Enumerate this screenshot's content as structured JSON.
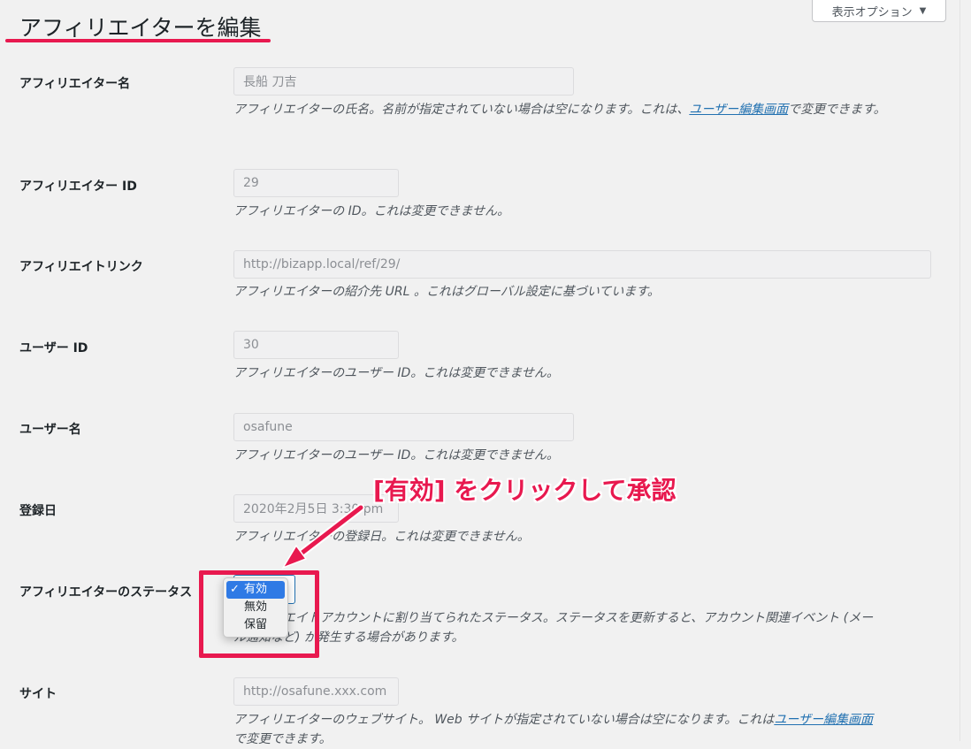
{
  "screen_options": {
    "label": "表示オプション",
    "arrow": "▼"
  },
  "page_title": "アフィリエイターを編集",
  "fields": {
    "name": {
      "label": "アフィリエイター名",
      "value": "長船 刀吉",
      "desc_before": "アフィリエイターの氏名。名前が指定されていない場合は空になります。これは、",
      "desc_link": "ユーザー編集画面",
      "desc_after": "で変更できます。"
    },
    "affiliate_id": {
      "label": "アフィリエイター ID",
      "value": "29",
      "desc": "アフィリエイターの ID。これは変更できません。"
    },
    "affiliate_link": {
      "label": "アフィリエイトリンク",
      "value": "http://bizapp.local/ref/29/",
      "desc": "アフィリエイターの紹介先 URL 。これはグローバル設定に基づいています。"
    },
    "user_id": {
      "label": "ユーザー ID",
      "value": "30",
      "desc": "アフィリエイターのユーザー ID。これは変更できません。"
    },
    "username": {
      "label": "ユーザー名",
      "value": "osafune",
      "desc": "アフィリエイターのユーザー ID。これは変更できません。"
    },
    "registered": {
      "label": "登録日",
      "value": "2020年2月5日 3:30 pm",
      "desc": "アフィリエイターの登録日。これは変更できません。"
    },
    "status": {
      "label": "アフィリエイターのステータス",
      "desc_line1": "アフィリエイトアカウントに割り当てられたステータス。ステータスを更新すると、アカウント関連イベント (メー",
      "desc_line2": "ル通知など) が発生する場合があります。",
      "options": [
        "有効",
        "無効",
        "保留"
      ],
      "selected": "有効",
      "check": "✓"
    },
    "site": {
      "label": "サイト",
      "value": "http://osafune.xxx.com",
      "desc_before": "アフィリエイターのウェブサイト。 Web サイトが指定されていない場合は空になります。これは",
      "desc_link": "ユーザー編集画面",
      "desc_after": "で変更できます。"
    }
  },
  "annotation": {
    "text": "[有効] をクリックして承認",
    "color": "#e8194f"
  }
}
